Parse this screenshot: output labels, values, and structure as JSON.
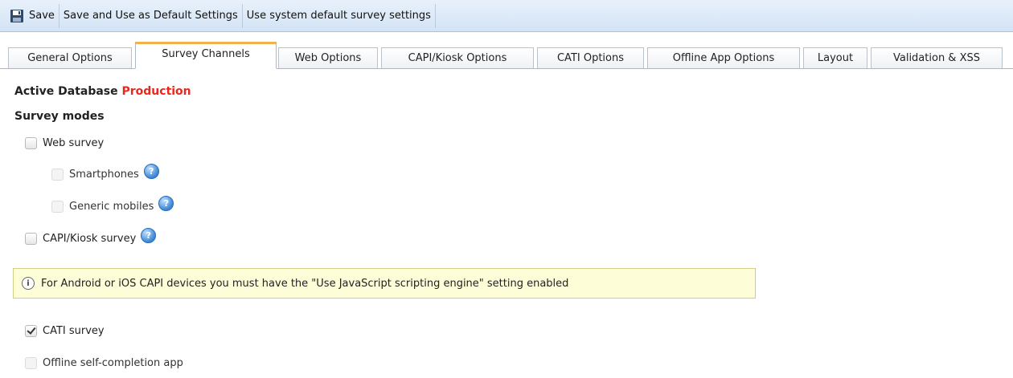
{
  "toolbar": {
    "save_label": "Save",
    "save_default_label": "Save and Use as Default Settings",
    "use_system_default_label": "Use system default survey settings"
  },
  "tabs": [
    {
      "label": "General Options"
    },
    {
      "label": "Survey Channels"
    },
    {
      "label": "Web Options"
    },
    {
      "label": "CAPI/Kiosk Options"
    },
    {
      "label": "CATI Options"
    },
    {
      "label": "Offline App Options"
    },
    {
      "label": "Layout"
    },
    {
      "label": "Validation & XSS"
    }
  ],
  "active_tab": "Survey Channels",
  "database": {
    "label": "Active Database",
    "value": "Production",
    "value_color": "#e8281e"
  },
  "survey_modes": {
    "heading": "Survey modes",
    "options": {
      "web": {
        "label": "Web survey",
        "checked": false,
        "disabled": false
      },
      "smartphones": {
        "label": "Smartphones",
        "checked": false,
        "disabled": true
      },
      "generic_mobiles": {
        "label": "Generic mobiles",
        "checked": false,
        "disabled": true
      },
      "capi": {
        "label": "CAPI/Kiosk survey",
        "checked": false,
        "disabled": false
      },
      "cati": {
        "label": "CATI survey",
        "checked": true,
        "disabled": false
      },
      "offline": {
        "label": "Offline self-completion app",
        "checked": false,
        "disabled": true
      }
    }
  },
  "notice": {
    "text": "For Android or iOS CAPI devices you must have the \"Use JavaScript scripting engine\" setting enabled"
  },
  "icons": {
    "save": "floppy-disk-icon",
    "help": "help-question-icon",
    "info": "info-icon"
  },
  "colors": {
    "toolbar_bg": "#d3e3f5",
    "active_tab_accent": "#f0b24b",
    "notice_bg": "#fdfdd8"
  }
}
